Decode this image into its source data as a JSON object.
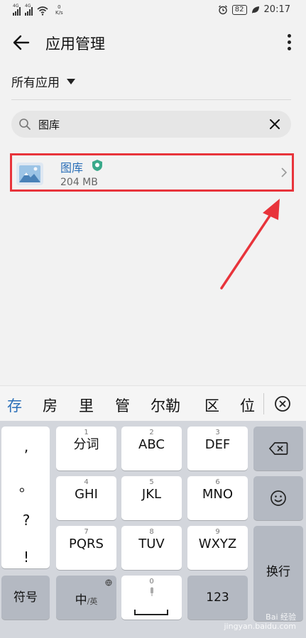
{
  "status_bar": {
    "signal_1_label": "4G",
    "signal_2_label": "4G",
    "speed_value": "0",
    "speed_unit": "K/s",
    "battery": "82",
    "time": "20:17"
  },
  "header": {
    "title": "应用管理"
  },
  "filter": {
    "label": "所有应用"
  },
  "search": {
    "value": "图库"
  },
  "app_list": [
    {
      "name": "图库",
      "size": "204 MB"
    }
  ],
  "candidates": [
    "存",
    "房",
    "里",
    "管",
    "尔勒",
    "区",
    "位"
  ],
  "keyboard": {
    "punct": [
      ",",
      "。",
      "?",
      "!"
    ],
    "keys": [
      {
        "num": "1",
        "label": "分词"
      },
      {
        "num": "2",
        "label": "ABC"
      },
      {
        "num": "3",
        "label": "DEF"
      },
      {
        "num": "4",
        "label": "GHI"
      },
      {
        "num": "5",
        "label": "JKL"
      },
      {
        "num": "6",
        "label": "MNO"
      },
      {
        "num": "7",
        "label": "PQRS"
      },
      {
        "num": "8",
        "label": "TUV"
      },
      {
        "num": "9",
        "label": "WXYZ"
      }
    ],
    "enter_label": "换行",
    "symbol_label": "符号",
    "lang_label_main": "中",
    "lang_label_sub": "/英",
    "space_num": "0",
    "num_label": "123"
  },
  "watermark": {
    "line1": "Bai 经验",
    "line2": "jingyan.baidu.com"
  },
  "colors": {
    "accent": "#2a6fb8",
    "highlight_border": "#e8343b",
    "shield": "#3aa98a"
  }
}
